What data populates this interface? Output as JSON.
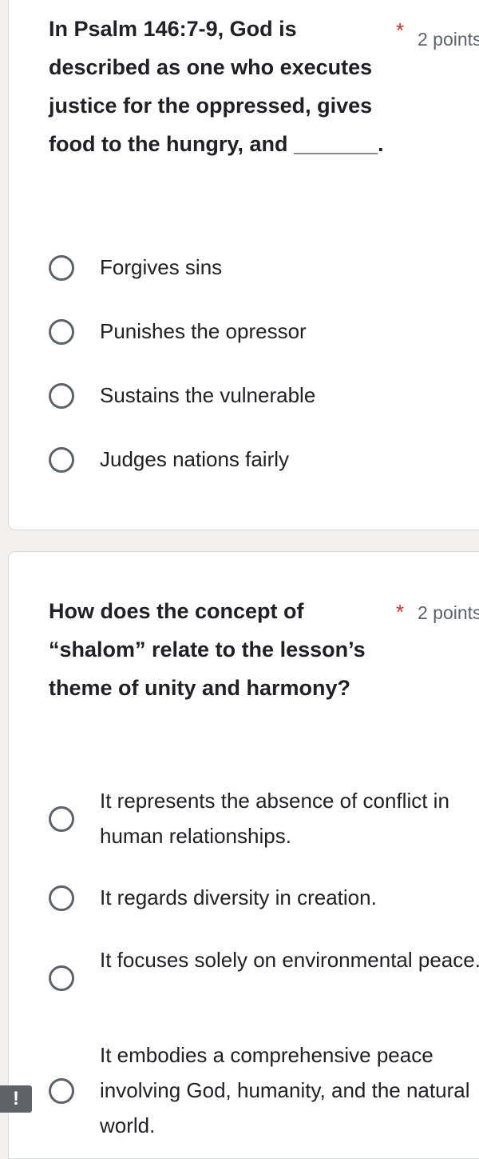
{
  "questions": [
    {
      "text": "In Psalm 146:7-9, God is described as one who executes justice for the oppressed, gives food to the hungry, and _______.",
      "required_mark": "*",
      "points": "2 points",
      "options": [
        "Forgives sins",
        "Punishes the opressor",
        "Sustains the vulnerable",
        "Judges nations fairly"
      ]
    },
    {
      "text": "How does the concept of “shalom” relate to the lesson’s theme of unity and harmony?",
      "required_mark": "*",
      "points": "2 points",
      "options": [
        "It represents the absence of conflict in human relationships.",
        "It regards diversity in creation.",
        "It focuses solely on environmental peace.",
        "It embodies a comprehensive peace involving God, humanity, and the natural world."
      ]
    }
  ],
  "alert_badge": "!"
}
